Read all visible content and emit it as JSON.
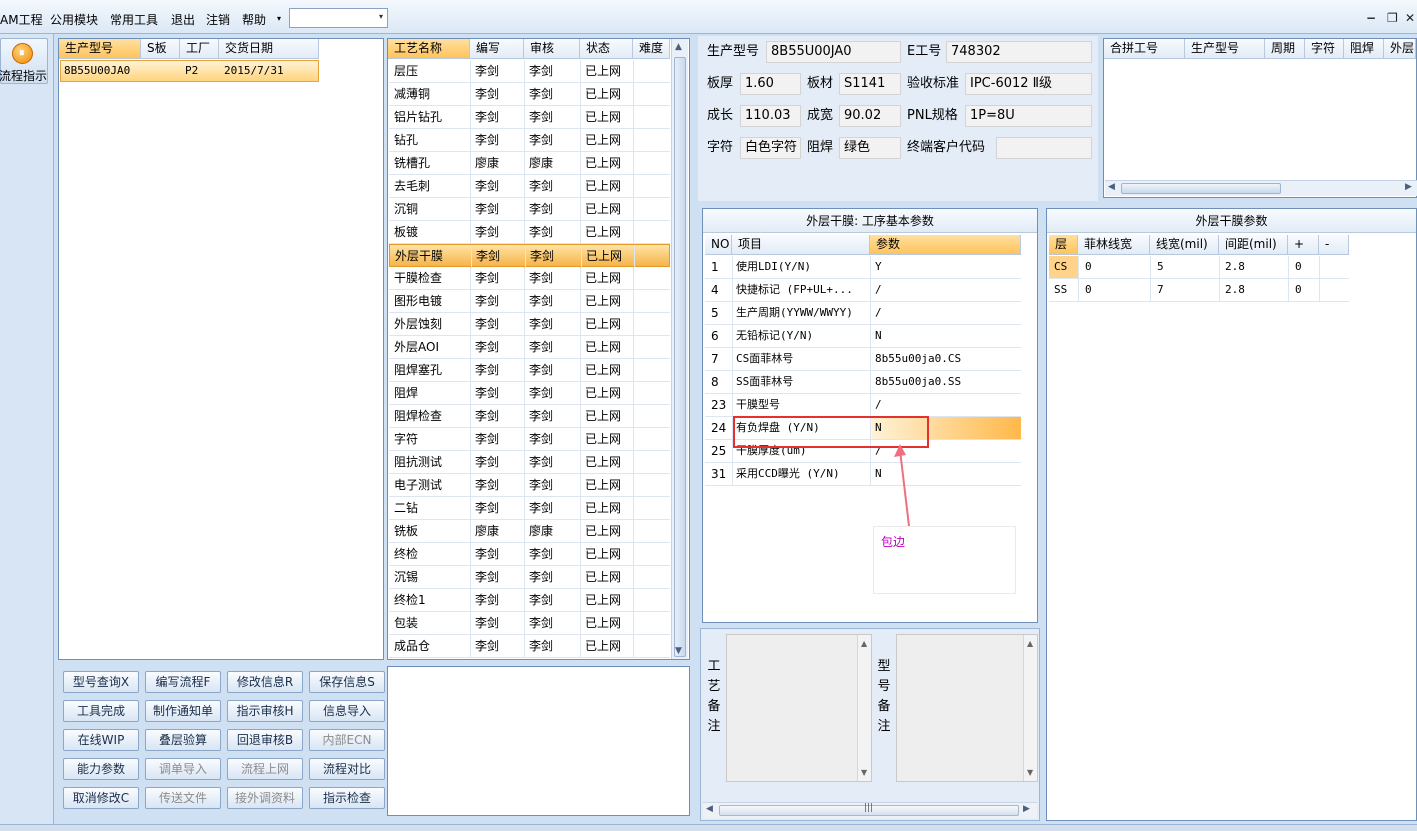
{
  "menu": {
    "items": [
      "AM工程",
      "公用模块",
      "常用工具",
      "退出",
      "注销",
      "帮助"
    ],
    "dropdown_glyph": "▾",
    "combo_value": "",
    "window_controls": [
      "−",
      "❐",
      "✕"
    ]
  },
  "sidebar": {
    "flow_button_label": "流程指示",
    "icon": "flow-indicator-icon"
  },
  "orders": {
    "columns": [
      "生产型号",
      "S板",
      "工厂",
      "交货日期"
    ],
    "rows": [
      [
        "8B55U00JA0",
        "",
        "P2",
        "2015/7/31"
      ]
    ]
  },
  "processes": {
    "columns": [
      "工艺名称",
      "编写",
      "审核",
      "状态",
      "难度"
    ],
    "selected_index": 8,
    "rows": [
      [
        "层压",
        "李剑",
        "李剑",
        "已上网",
        ""
      ],
      [
        "减薄铜",
        "李剑",
        "李剑",
        "已上网",
        ""
      ],
      [
        "铝片钻孔",
        "李剑",
        "李剑",
        "已上网",
        ""
      ],
      [
        "钻孔",
        "李剑",
        "李剑",
        "已上网",
        ""
      ],
      [
        "铣槽孔",
        "廖康",
        "廖康",
        "已上网",
        ""
      ],
      [
        "去毛刺",
        "李剑",
        "李剑",
        "已上网",
        ""
      ],
      [
        "沉铜",
        "李剑",
        "李剑",
        "已上网",
        ""
      ],
      [
        "板镀",
        "李剑",
        "李剑",
        "已上网",
        ""
      ],
      [
        "外层干膜",
        "李剑",
        "李剑",
        "已上网",
        ""
      ],
      [
        "干膜检查",
        "李剑",
        "李剑",
        "已上网",
        ""
      ],
      [
        "图形电镀",
        "李剑",
        "李剑",
        "已上网",
        ""
      ],
      [
        "外层蚀刻",
        "李剑",
        "李剑",
        "已上网",
        ""
      ],
      [
        "外层AOI",
        "李剑",
        "李剑",
        "已上网",
        ""
      ],
      [
        "阻焊塞孔",
        "李剑",
        "李剑",
        "已上网",
        ""
      ],
      [
        "阻焊",
        "李剑",
        "李剑",
        "已上网",
        ""
      ],
      [
        "阻焊检查",
        "李剑",
        "李剑",
        "已上网",
        ""
      ],
      [
        "字符",
        "李剑",
        "李剑",
        "已上网",
        ""
      ],
      [
        "阻抗测试",
        "李剑",
        "李剑",
        "已上网",
        ""
      ],
      [
        "电子测试",
        "李剑",
        "李剑",
        "已上网",
        ""
      ],
      [
        "二钻",
        "李剑",
        "李剑",
        "已上网",
        ""
      ],
      [
        "铣板",
        "廖康",
        "廖康",
        "已上网",
        ""
      ],
      [
        "终检",
        "李剑",
        "李剑",
        "已上网",
        ""
      ],
      [
        "沉锡",
        "李剑",
        "李剑",
        "已上网",
        ""
      ],
      [
        "终检1",
        "李剑",
        "李剑",
        "已上网",
        ""
      ],
      [
        "包装",
        "李剑",
        "李剑",
        "已上网",
        ""
      ],
      [
        "成品仓",
        "李剑",
        "李剑",
        "已上网",
        ""
      ]
    ]
  },
  "buttons": [
    {
      "label": "型号查询X",
      "enabled": true
    },
    {
      "label": "编写流程F",
      "enabled": true
    },
    {
      "label": "修改信息R",
      "enabled": true
    },
    {
      "label": "保存信息S",
      "enabled": true
    },
    {
      "label": "工具完成",
      "enabled": true
    },
    {
      "label": "制作通知单",
      "enabled": true
    },
    {
      "label": "指示审核H",
      "enabled": true
    },
    {
      "label": "信息导入",
      "enabled": true
    },
    {
      "label": "在线WIP",
      "enabled": true
    },
    {
      "label": "叠层验算",
      "enabled": true
    },
    {
      "label": "回退审核B",
      "enabled": true
    },
    {
      "label": "内部ECN",
      "enabled": false
    },
    {
      "label": "能力参数",
      "enabled": true
    },
    {
      "label": "调单导入",
      "enabled": false
    },
    {
      "label": "流程上网",
      "enabled": false
    },
    {
      "label": "流程对比",
      "enabled": true
    },
    {
      "label": "取消修改C",
      "enabled": true
    },
    {
      "label": "传送文件",
      "enabled": false
    },
    {
      "label": "接外调资料",
      "enabled": false
    },
    {
      "label": "指示检查",
      "enabled": true
    }
  ],
  "info": {
    "model_label": "生产型号",
    "model_value": "8B55U00JA0",
    "eno_label": "E工号",
    "eno_value": "748302",
    "thickness_label": "板厚",
    "thickness_value": "1.60",
    "material_label": "板材",
    "material_value": "S1141",
    "standard_label": "验收标准",
    "standard_value": "IPC-6012 Ⅱ级",
    "length_label": "成长",
    "length_value": "110.03",
    "width_label": "成宽",
    "width_value": "90.02",
    "pnl_label": "PNL规格",
    "pnl_value": "1P=8U",
    "char_label": "字符",
    "char_value": "白色字符",
    "mask_label": "阻焊",
    "mask_value": "绿色",
    "customer_label": "终端客户代码",
    "customer_value": ""
  },
  "combine": {
    "columns": [
      "合拼工号",
      "生产型号",
      "周期",
      "字符",
      "阻焊",
      "外层"
    ]
  },
  "params": {
    "title": "外层干膜: 工序基本参数",
    "columns": [
      "NO",
      "项目",
      "参数"
    ],
    "selected_index": 7,
    "rows": [
      [
        "1",
        "使用LDI(Y/N)",
        "Y"
      ],
      [
        "4",
        "快捷标记 (FP+UL+...",
        "/"
      ],
      [
        "5",
        "生产周期(YYWW/WWYY)",
        "/"
      ],
      [
        "6",
        "无铅标记(Y/N)",
        "N"
      ],
      [
        "7",
        "CS面菲林号",
        "8b55u00ja0.CS"
      ],
      [
        "8",
        "SS面菲林号",
        "8b55u00ja0.SS"
      ],
      [
        "23",
        "干膜型号",
        "/"
      ],
      [
        "24",
        "有负焊盘 (Y/N)",
        "N"
      ],
      [
        "25",
        "干膜厚度(um)",
        "/"
      ],
      [
        "31",
        "采用CCD曝光 (Y/N)",
        "N"
      ]
    ]
  },
  "annotation": {
    "text": "包边",
    "color": "#e53030"
  },
  "outer": {
    "title": "外层干膜参数",
    "columns": [
      "层",
      "菲林线宽",
      "线宽(mil)",
      "间距(mil)",
      "+",
      "-"
    ],
    "rows": [
      [
        "CS",
        "0",
        "5",
        "2.8",
        "0",
        ""
      ],
      [
        "SS",
        "0",
        "7",
        "2.8",
        "0",
        ""
      ]
    ]
  },
  "remarks": {
    "process_label": "工艺备注",
    "model_label": "型号备注",
    "scroll_glyph": "|||"
  }
}
